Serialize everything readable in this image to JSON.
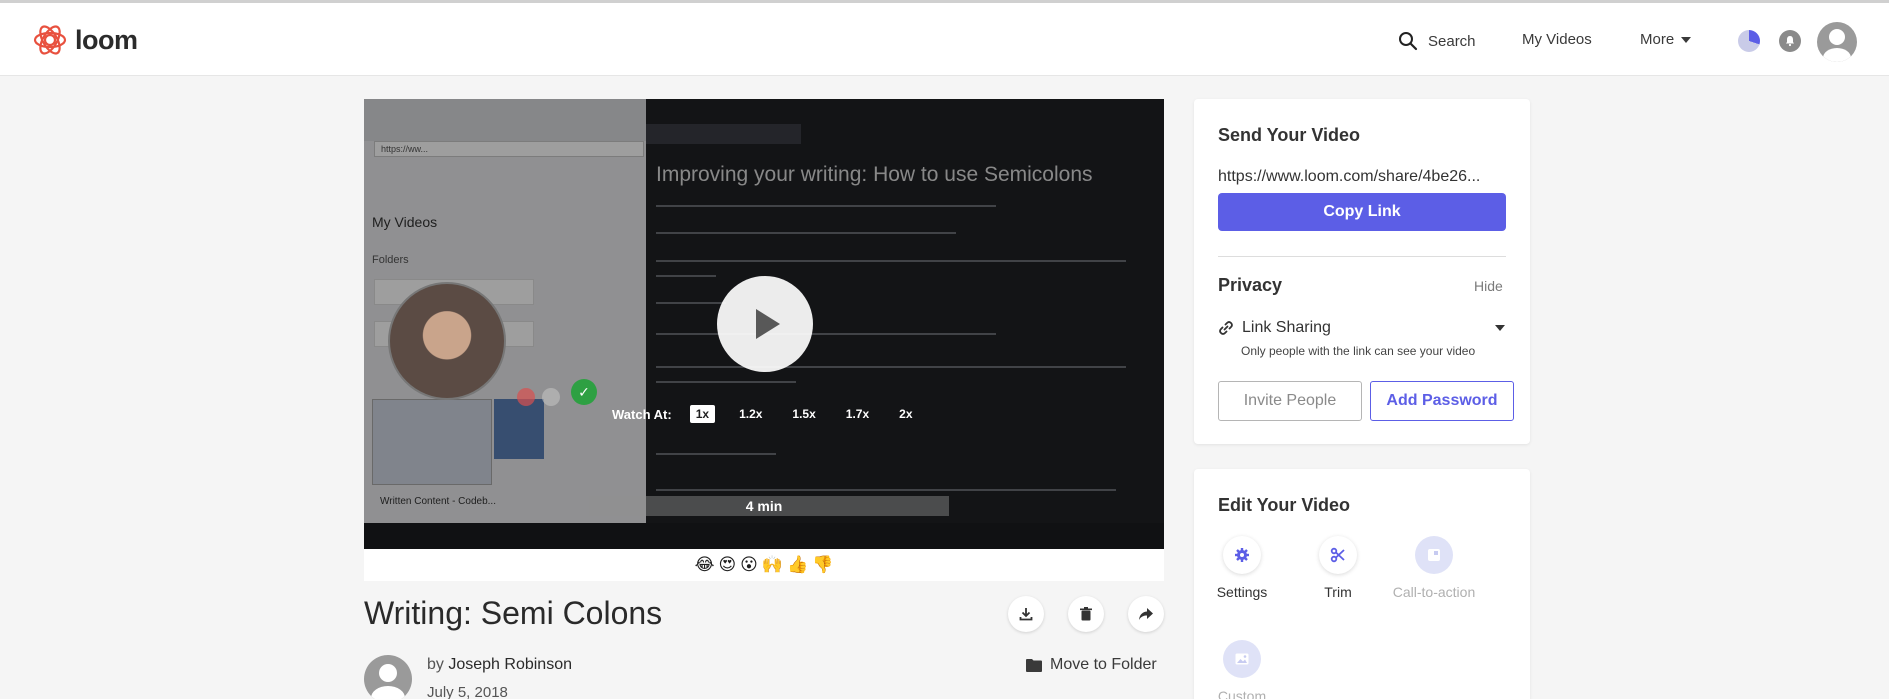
{
  "brand": {
    "name": "loom",
    "accent": "#5c5ee6"
  },
  "nav": {
    "search": "Search",
    "my_videos": "My Videos",
    "more": "More"
  },
  "video": {
    "screen_title": "Improving your writing: How to use Semicolons",
    "left_panel": {
      "url": "https://ww...",
      "my_videos": "My Videos",
      "folders": "Folders",
      "written_content": "Written Content - Codeb..."
    },
    "watch_at_label": "Watch At:",
    "speeds": [
      "1x",
      "1.2x",
      "1.5x",
      "1.7x",
      "2x"
    ],
    "active_speed": "1x",
    "duration": "4 min"
  },
  "reactions": [
    "😂",
    "😍",
    "😮",
    "🙌",
    "👍",
    "👎"
  ],
  "video_title": "Writing: Semi Colons",
  "author": {
    "by": "by",
    "name": "Joseph Robinson",
    "date": "July 5, 2018"
  },
  "move_to_folder": "Move to Folder",
  "send": {
    "title": "Send Your Video",
    "url": "https://www.loom.com/share/4be26...",
    "copy_label": "Copy Link",
    "privacy_title": "Privacy",
    "hide": "Hide",
    "link_sharing": "Link Sharing",
    "link_hint": "Only people with the link can see your video",
    "invite": "Invite People",
    "add_password": "Add Password"
  },
  "edit": {
    "title": "Edit Your Video",
    "tools": [
      {
        "label": "Settings"
      },
      {
        "label": "Trim"
      },
      {
        "label": "Call-to-action"
      },
      {
        "label": "Custom"
      }
    ]
  }
}
